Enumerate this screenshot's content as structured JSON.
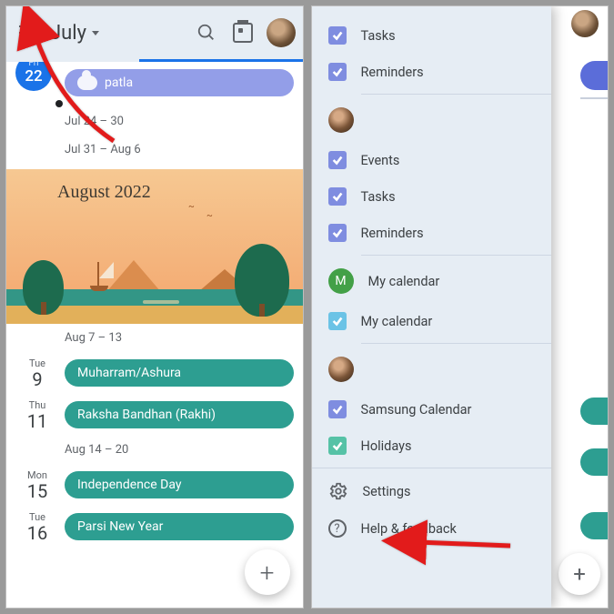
{
  "left": {
    "month": "July",
    "current": {
      "weekday": "Fri",
      "daynum": "22",
      "event": "patla"
    },
    "weeks": [
      {
        "range": "Jul 24 – 30"
      },
      {
        "range": "Jul 31 – Aug 6"
      }
    ],
    "month_header": "August 2022",
    "week_aug1": "Aug 7 – 13",
    "days1": [
      {
        "wd": "Tue",
        "dn": "9",
        "event": "Muharram/Ashura"
      },
      {
        "wd": "Thu",
        "dn": "11",
        "event": "Raksha Bandhan (Rakhi)"
      }
    ],
    "week_aug2": "Aug 14 – 20",
    "days2": [
      {
        "wd": "Mon",
        "dn": "15",
        "event": "Independence Day"
      },
      {
        "wd": "Tue",
        "dn": "16",
        "event": "Parsi New Year"
      }
    ]
  },
  "drawer": {
    "group1": [
      {
        "label": "Tasks",
        "color": "c-purple"
      },
      {
        "label": "Reminders",
        "color": "c-purple"
      }
    ],
    "account1_items": [
      {
        "label": "Events",
        "color": "c-purple"
      },
      {
        "label": "Tasks",
        "color": "c-purple"
      },
      {
        "label": "Reminders",
        "color": "c-purple"
      }
    ],
    "mycal_letter": "M",
    "mycal_label": "My calendar",
    "mycal_item": "My calendar",
    "samsung": "Samsung Calendar",
    "holidays": "Holidays",
    "settings": "Settings",
    "help": "Help & feedback"
  }
}
